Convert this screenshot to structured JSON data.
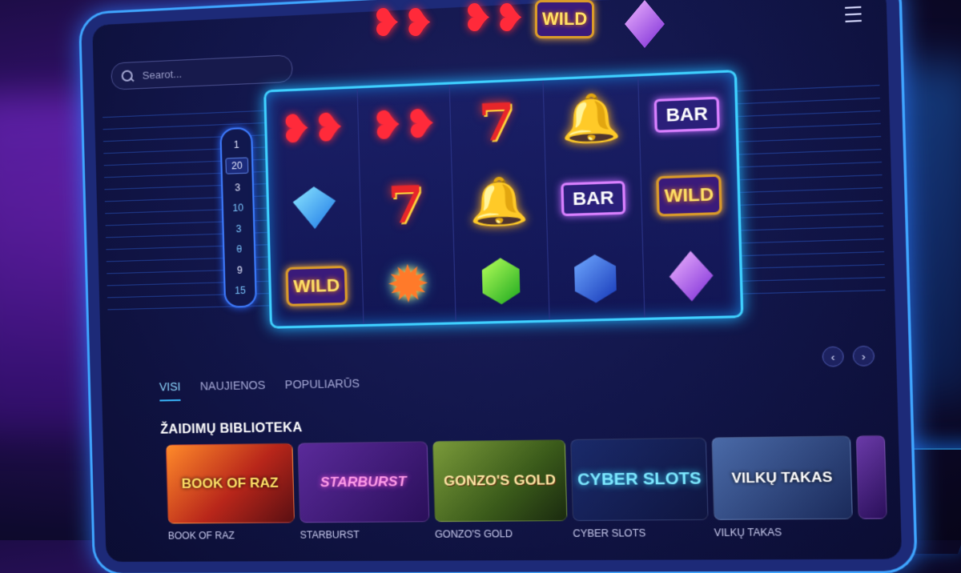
{
  "search": {
    "placeholder": "Searot..."
  },
  "paylines": [
    {
      "label": "1",
      "style": "plain"
    },
    {
      "label": "20",
      "style": "boxed"
    },
    {
      "label": "3",
      "style": "plain"
    },
    {
      "label": "10",
      "style": "hl"
    },
    {
      "label": "3",
      "style": "hl"
    },
    {
      "label": "θ",
      "style": "hl"
    },
    {
      "label": "9",
      "style": "plain"
    },
    {
      "label": "15",
      "style": "hl"
    }
  ],
  "reels": {
    "rows": [
      [
        "cherry",
        "cherry",
        "seven",
        "bell",
        "bar"
      ],
      [
        "diamond",
        "seven",
        "bell",
        "bar",
        "wild"
      ],
      [
        "wild",
        "starburst",
        "emerald",
        "sapphire",
        "amethyst"
      ]
    ],
    "symbol_text": {
      "seven": "7",
      "bar": "BAR",
      "wild": "WILD"
    },
    "above_reels": [
      "cherry",
      "cherry",
      "wild",
      "amethyst"
    ]
  },
  "tabs": [
    {
      "label": "VISI",
      "active": true
    },
    {
      "label": "NAUJIENOS",
      "active": false
    },
    {
      "label": "POPULIARŪS",
      "active": false
    }
  ],
  "section_title": "ŽAIDIMŲ BIBLIOTEKA",
  "carousel": {
    "prev_icon": "chevron-left-icon",
    "next_icon": "chevron-right-icon"
  },
  "games": [
    {
      "title": "BOOK OF RAZ",
      "thumb_text": "BOOK OF RAZ",
      "style": "t-raz"
    },
    {
      "title": "STARBURST",
      "thumb_text": "STARBURST",
      "style": "t-star"
    },
    {
      "title": "GONZO'S GOLD",
      "thumb_text": "GONZO'S GOLD",
      "style": "t-gonzo"
    },
    {
      "title": "CYBER SLOTS",
      "thumb_text": "CYBER SLOTS",
      "style": "t-cyber"
    },
    {
      "title": "VILKŲ TAKAS",
      "thumb_text": "VILKŲ TAKAS",
      "style": "t-wolf"
    }
  ],
  "colors": {
    "accent": "#39b8ff",
    "background": "#0b0d33",
    "reel_border": "#3fd0ff"
  },
  "icons": {
    "search": "search-icon",
    "menu": "hamburger-menu-icon"
  }
}
